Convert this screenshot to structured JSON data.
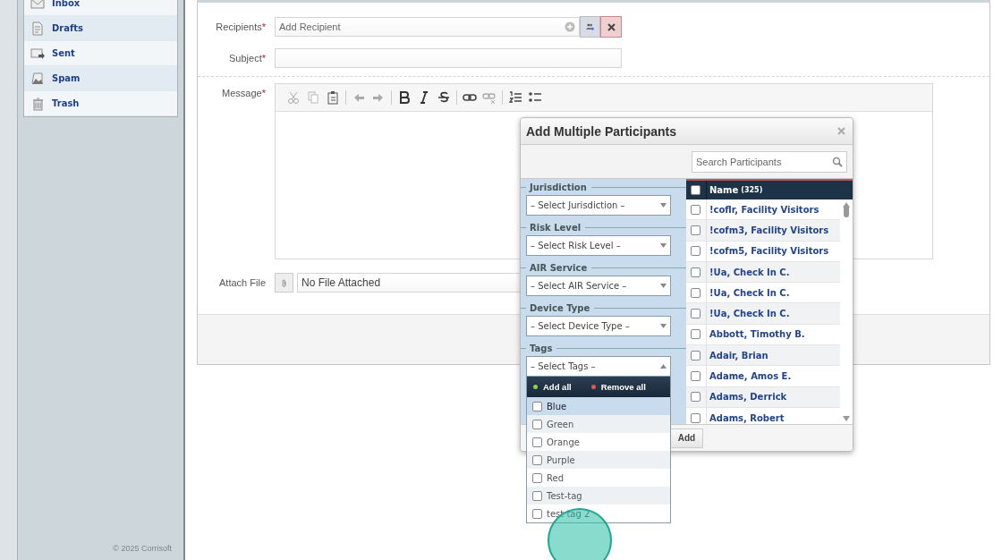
{
  "sidebar": {
    "items": [
      {
        "label": "Inbox"
      },
      {
        "label": "Drafts"
      },
      {
        "label": "Sent"
      },
      {
        "label": "Spam"
      },
      {
        "label": "Trash"
      }
    ],
    "footer": "© 2025 Corrisoft"
  },
  "compose": {
    "recipients": {
      "label": "Recipients",
      "mark": "*",
      "placeholder": "Add Recipient"
    },
    "subject": {
      "label": "Subject",
      "mark": "*"
    },
    "message": {
      "label": "Message",
      "mark": "*"
    },
    "attach": {
      "label": "Attach File",
      "value": "No File Attached"
    }
  },
  "modal": {
    "title": "Add Multiple Participants",
    "search": {
      "placeholder": "Search Participants"
    },
    "filters": [
      {
        "label": "Jurisdiction",
        "value": "– Select Jurisdiction –",
        "expanded": false
      },
      {
        "label": "Risk Level",
        "value": "– Select Risk Level –",
        "expanded": false
      },
      {
        "label": "AIR Service",
        "value": "– Select AIR Service –",
        "expanded": false
      },
      {
        "label": "Device Type",
        "value": "– Select Device Type –",
        "expanded": false
      },
      {
        "label": "Tags",
        "value": "– Select Tags –",
        "expanded": true
      }
    ],
    "list": {
      "header": "Name",
      "count": "(325)",
      "checked": false,
      "rows": [
        {
          "name": "!coflr, Facility Visitors",
          "checked": false
        },
        {
          "name": "!cofm3, Facility Visitors",
          "checked": false
        },
        {
          "name": "!cofm5, Facility Visitors",
          "checked": false
        },
        {
          "name": "!Ua, Check In C.",
          "checked": false
        },
        {
          "name": "!Ua, Check In C.",
          "checked": false
        },
        {
          "name": "!Ua, Check In C.",
          "checked": false
        },
        {
          "name": "Abbott, Timothy B.",
          "checked": false
        },
        {
          "name": "Adair, Brian",
          "checked": false
        },
        {
          "name": "Adame, Amos E.",
          "checked": false
        },
        {
          "name": "Adams, Derrick",
          "checked": false
        },
        {
          "name": "Adams, Robert",
          "checked": false
        }
      ]
    },
    "add_button": "Add"
  },
  "tags_dropdown": {
    "add_all": "Add all",
    "remove_all": "Remove all",
    "options": [
      {
        "label": "Blue",
        "checked": false,
        "selected": true
      },
      {
        "label": "Green",
        "checked": false,
        "selected": false
      },
      {
        "label": "Orange",
        "checked": false,
        "selected": false
      },
      {
        "label": "Purple",
        "checked": false,
        "selected": false
      },
      {
        "label": "Red",
        "checked": false,
        "selected": false
      },
      {
        "label": "Test-tag",
        "checked": false,
        "selected": false
      },
      {
        "label": "test tag 2",
        "checked": false,
        "selected": false
      }
    ]
  }
}
